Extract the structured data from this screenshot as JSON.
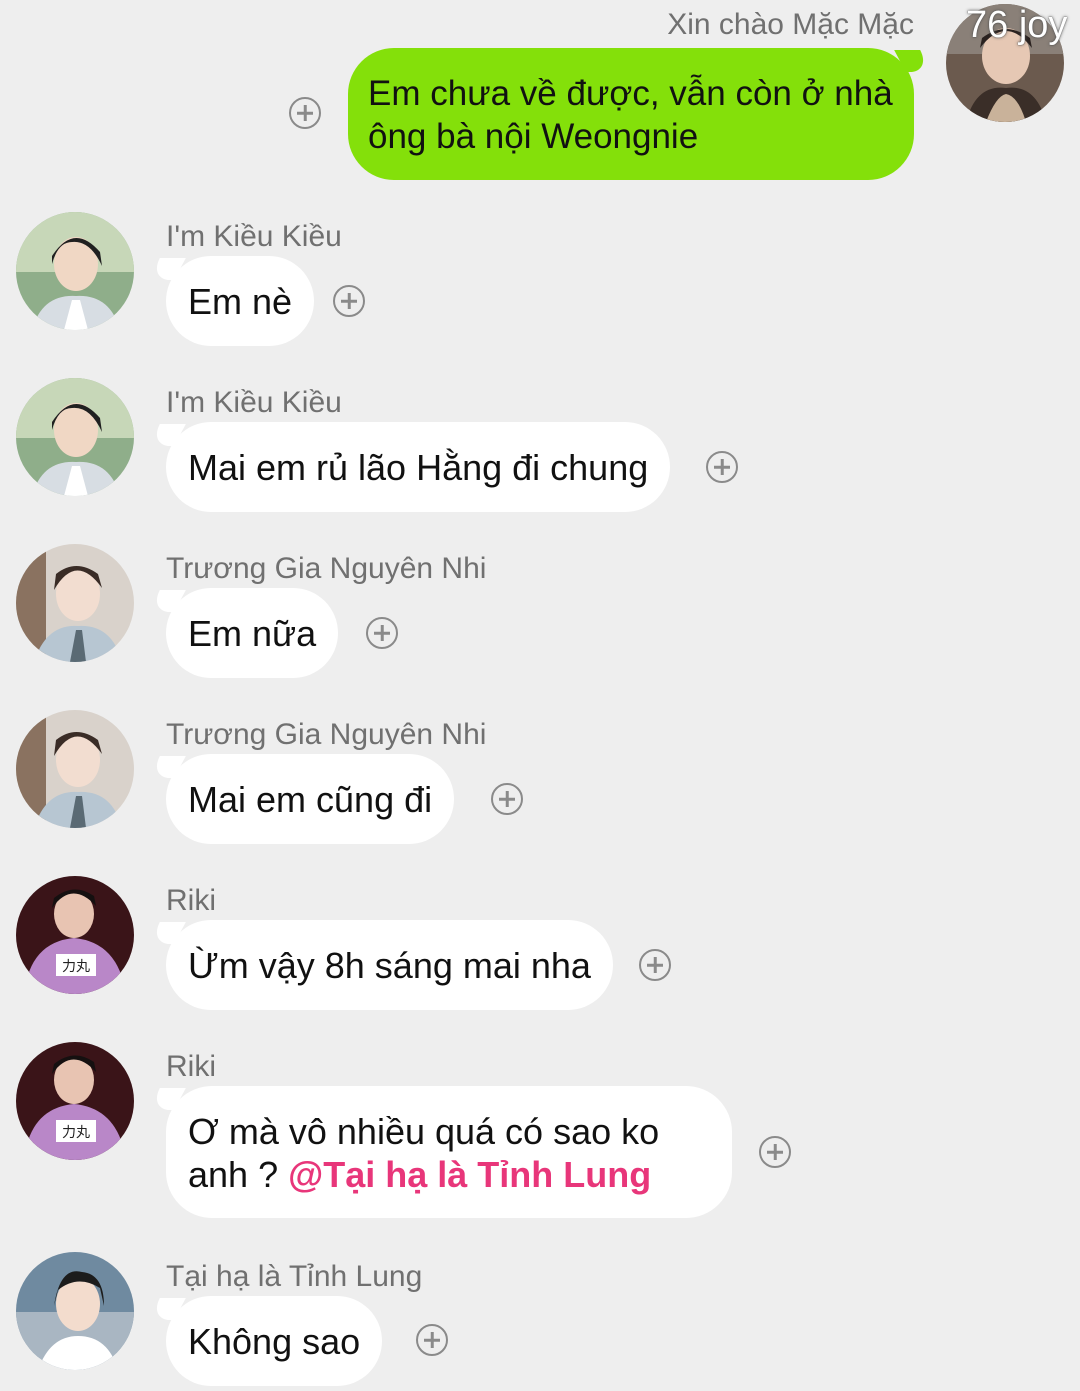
{
  "outgoing": {
    "sender": "Xin chào Mặc Mặc",
    "avatar_label": "76 joy",
    "text": "Em chưa về được, vẫn còn ở nhà ông bà nội Weongnie",
    "bubble_color": "#84e00a"
  },
  "messages": [
    {
      "sender": "I'm Kiều Kiều",
      "text": "Em nè"
    },
    {
      "sender": "I'm Kiều Kiều",
      "text": "Mai em rủ lão Hằng đi chung"
    },
    {
      "sender": "Trương Gia Nguyên Nhi",
      "text": "Em nữa"
    },
    {
      "sender": "Trương Gia Nguyên Nhi",
      "text": "Mai em cũng đi"
    },
    {
      "sender": "Riki",
      "text": "Ừm vậy 8h sáng mai nha"
    },
    {
      "sender": "Riki",
      "text": "Ơ mà vô nhiều quá có sao ko anh ?",
      "mention": "@Tại hạ là Tỉnh Lung"
    },
    {
      "sender": "Tại hạ là Tỉnh Lung",
      "text": "Không sao"
    }
  ],
  "icons": {
    "react": "add-reaction-icon"
  },
  "colors": {
    "background": "#eeeeee",
    "incoming_bubble": "#ffffff",
    "mention": "#e8367a",
    "sender_name": "#707070"
  }
}
